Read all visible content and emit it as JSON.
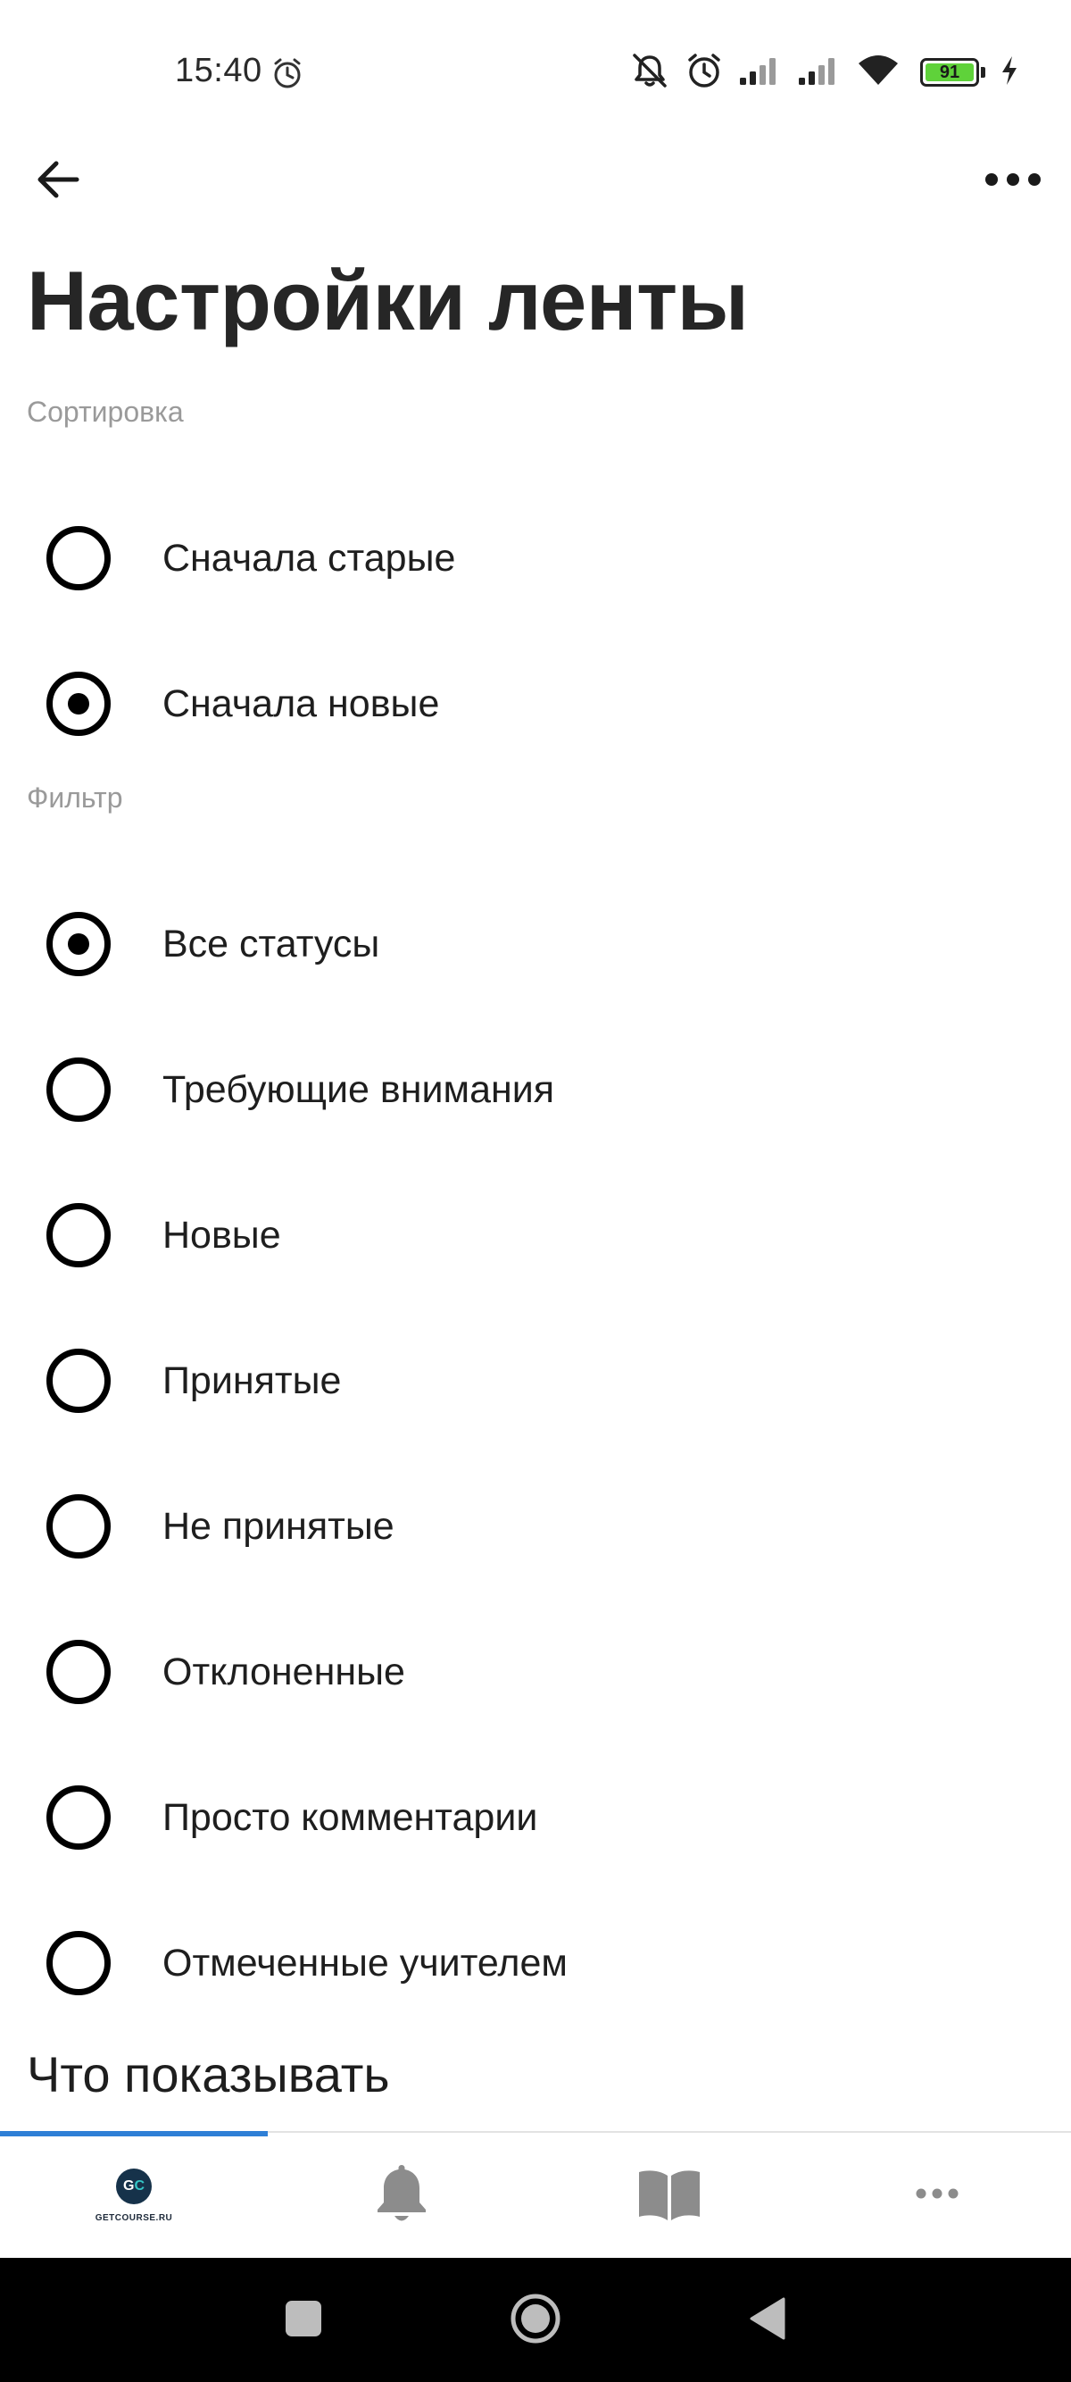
{
  "status_bar": {
    "time": "15:40",
    "battery_level": "91",
    "icons": [
      "alarm-icon",
      "mute-icon",
      "alarm-icon",
      "signal-icon",
      "signal-icon",
      "wifi-icon",
      "battery-icon",
      "charging-icon"
    ]
  },
  "app_bar": {
    "back_icon": "arrow-left-icon",
    "more_icon": "more-horizontal-icon"
  },
  "title": "Настройки ленты",
  "sorting": {
    "label": "Сортировка",
    "options": [
      {
        "label": "Сначала старые",
        "checked": false
      },
      {
        "label": "Сначала новые",
        "checked": true
      }
    ]
  },
  "filter": {
    "label": "Фильтр",
    "options": [
      {
        "label": "Все статусы",
        "checked": true
      },
      {
        "label": "Требующие внимания",
        "checked": false
      },
      {
        "label": "Новые",
        "checked": false
      },
      {
        "label": "Принятые",
        "checked": false
      },
      {
        "label": "Не принятые",
        "checked": false
      },
      {
        "label": "Отклоненные",
        "checked": false
      },
      {
        "label": "Просто комментарии",
        "checked": false
      },
      {
        "label": "Отмеченные учителем",
        "checked": false
      }
    ]
  },
  "what_to_show": {
    "heading": "Что показывать"
  },
  "tab_bar": {
    "tabs": [
      {
        "icon": "getcourse-logo",
        "logo_text": "GETCOURSE.RU",
        "active": true
      },
      {
        "icon": "bell-icon",
        "active": false
      },
      {
        "icon": "book-icon",
        "active": false
      },
      {
        "icon": "more-horizontal-icon",
        "active": false
      }
    ],
    "active_color": "#2f7fd6",
    "inactive_color": "#8c8c8c"
  },
  "nav_bar": {
    "buttons": [
      "recents-square-icon",
      "home-circle-icon",
      "back-triangle-icon"
    ]
  }
}
